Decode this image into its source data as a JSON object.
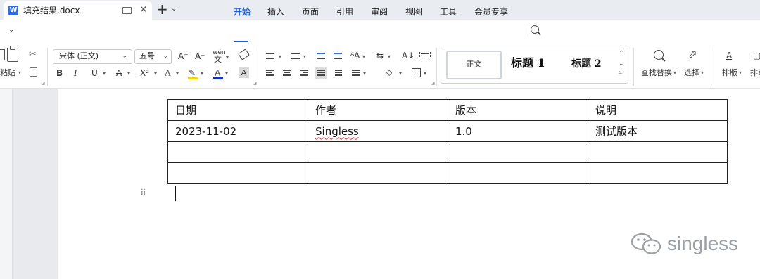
{
  "window": {
    "tab_title": "填充结果.docx",
    "tab_icon_letter": "W"
  },
  "menu": {
    "tabs": [
      "开始",
      "插入",
      "页面",
      "引用",
      "审阅",
      "视图",
      "工具",
      "会员专享"
    ],
    "active_tab": "开始"
  },
  "ribbon": {
    "clipboard": {
      "paste_label": "粘贴"
    },
    "font": {
      "family": "宋体 (正文)",
      "size": "五号"
    },
    "format_labels": {
      "bold": "B",
      "italic": "I",
      "underline": "U",
      "strike": "A",
      "superscript": "X²",
      "font_color_letter": "A",
      "highlight_letter": "A"
    },
    "styles": {
      "normal": "正文",
      "heading1": "标题 1",
      "heading2": "标题 2"
    },
    "find_replace_label": "查找替换",
    "select_label": "选择",
    "layout_label": "排版",
    "sort_label_partial": "排系",
    "font_grow": "A⁺",
    "font_shrink": "A⁻",
    "pinyin": "wén"
  },
  "document": {
    "table": {
      "headers": [
        "日期",
        "作者",
        "版本",
        "说明"
      ],
      "rows": [
        [
          "2023-11-02",
          "Singless",
          "1.0",
          "测试版本"
        ],
        [
          "",
          "",
          "",
          ""
        ],
        [
          "",
          "",
          "",
          ""
        ]
      ]
    }
  },
  "watermark": {
    "text": "singless"
  },
  "colors": {
    "accent": "#1e5fe0",
    "tab_bar": "#e9ecf1",
    "page_bg": "#ffffff",
    "workspace_bg": "#e9eaed",
    "font_color_red": "#d32020",
    "highlight_yellow": "#f5d800"
  }
}
